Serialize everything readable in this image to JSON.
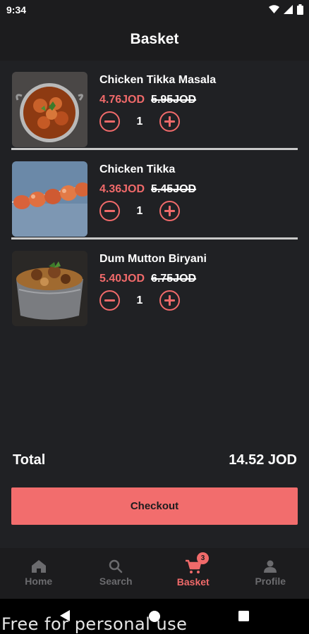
{
  "status_bar": {
    "time": "9:34"
  },
  "header": {
    "title": "Basket"
  },
  "items": [
    {
      "name": "Chicken Tikka Masala",
      "price": "4.76JOD",
      "old_price": "5.95JOD",
      "quantity": "1",
      "image_icon": "food-photo"
    },
    {
      "name": "Chicken Tikka",
      "price": "4.36JOD",
      "old_price": "5.45JOD",
      "quantity": "1",
      "image_icon": "food-photo"
    },
    {
      "name": "Dum Mutton Biryani",
      "price": "5.40JOD",
      "old_price": "6.75JOD",
      "quantity": "1",
      "image_icon": "food-photo"
    }
  ],
  "summary": {
    "total_label": "Total",
    "total_value": "14.52 JOD"
  },
  "checkout": {
    "label": "Checkout"
  },
  "nav": {
    "items": [
      {
        "label": "Home",
        "icon": "home-icon"
      },
      {
        "label": "Search",
        "icon": "search-icon"
      },
      {
        "label": "Basket",
        "icon": "cart-icon",
        "badge": "3"
      },
      {
        "label": "Profile",
        "icon": "person-icon"
      }
    ],
    "active_index": 2
  },
  "watermark": "Free for personal use",
  "colors": {
    "accent": "#f06a6a",
    "background": "#202124",
    "bar": "#1c1c1e"
  }
}
